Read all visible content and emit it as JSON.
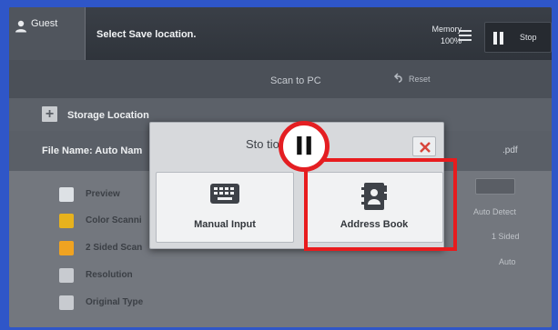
{
  "header": {
    "user_label": "Guest",
    "message": "Select Save location.",
    "memory_label": "Memory",
    "memory_value": "100%",
    "stop_label": "Stop"
  },
  "subheader": {
    "title": "Scan to PC",
    "reset_label": "Reset"
  },
  "main": {
    "storage_location_label": "Storage Location",
    "file_name_label": "File Name: Auto Nam",
    "file_extension": ".pdf",
    "list_items": [
      {
        "label": "Preview",
        "icon": "preview-icon",
        "color": "#dde1e5"
      },
      {
        "label": "Color Scanni",
        "icon": "color-scanning-icon",
        "color": "#e7b21d"
      },
      {
        "label": "2 Sided Scan",
        "icon": "two-sided-scanning-icon",
        "color": "#f0a321"
      },
      {
        "label": "Resolution",
        "icon": "resolution-icon",
        "color": "#c8cbd0"
      },
      {
        "label": "Original Type",
        "icon": "original-type-icon",
        "color": "#c8cbd0"
      }
    ],
    "side_values": [
      "Auto Detect",
      "1 Sided",
      "Auto"
    ]
  },
  "dialog": {
    "title": "Sto       tion",
    "option_manual_label": "Manual Input",
    "option_address_label": "Address Book"
  },
  "annotation": {
    "step_number": "II",
    "highlight_color": "#e81b1d"
  }
}
